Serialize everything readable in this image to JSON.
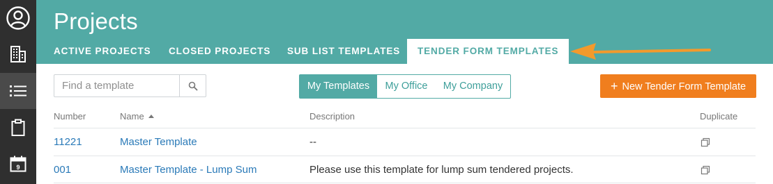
{
  "app": {
    "page_title": "Projects"
  },
  "rail": {
    "items": [
      {
        "icon": "user-circle-icon"
      },
      {
        "icon": "building-icon"
      },
      {
        "icon": "list-icon",
        "active": true
      },
      {
        "icon": "clipboard-icon"
      },
      {
        "icon": "calendar-icon",
        "day": "9"
      }
    ]
  },
  "tabs": [
    {
      "label": "ACTIVE PROJECTS"
    },
    {
      "label": "CLOSED PROJECTS"
    },
    {
      "label": "SUB LIST TEMPLATES"
    },
    {
      "label": "TENDER FORM TEMPLATES",
      "active": true
    }
  ],
  "search": {
    "placeholder": "Find a template",
    "value": ""
  },
  "filter": {
    "options": [
      "My Templates",
      "My Office",
      "My Company"
    ],
    "selected": "My Templates"
  },
  "actions": {
    "new_button_plus": "+",
    "new_button_label": "New Tender Form Template"
  },
  "table": {
    "columns": {
      "number": "Number",
      "name": "Name",
      "description": "Description",
      "duplicate": "Duplicate"
    },
    "sort_column": "name",
    "rows": [
      {
        "number": "11221",
        "name": "Master Template",
        "description": "--"
      },
      {
        "number": "001",
        "name": "Master Template - Lump Sum",
        "description": "Please use this template for lump sum tendered projects."
      }
    ]
  },
  "colors": {
    "teal": "#52aaa5",
    "orange": "#f07e1e",
    "rail": "#2f2f2f",
    "link": "#2a7ab8"
  }
}
